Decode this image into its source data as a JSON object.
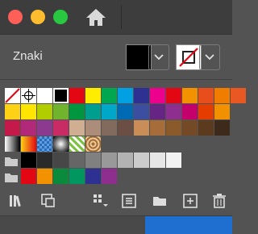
{
  "window": {
    "controls": [
      "close",
      "minimize",
      "maximize"
    ]
  },
  "panel": {
    "title": "Znaki"
  },
  "colors": {
    "row1": [
      "#ffffff",
      "#ffffff",
      "#000000",
      "#e30613",
      "#ffed00",
      "#00a650",
      "#00a0e3",
      "#2e3192",
      "#ec008c",
      "#e30613",
      "#f39200",
      "#e84e1b",
      "#f07d00",
      "#e95822"
    ],
    "row2": [
      "#fcd116",
      "#ffe600",
      "#b1cd00",
      "#6fb42c",
      "#00963f",
      "#009e8e",
      "#00a7c8",
      "#0069b4",
      "#3c4ea0",
      "#662483",
      "#8e2e8e",
      "#c3006b",
      "#e53d00",
      "#f19100"
    ],
    "row3": [
      "#c31a4a",
      "#b3297a",
      "#8b3a8f",
      "#c92c64",
      "#cfae91",
      "#ab8d7a",
      "#826a5c",
      "#6b4f44",
      "#c98d58",
      "#a66c39",
      "#8b5a2b",
      "#744a26",
      "#5c3a1e",
      "#3d2a1a"
    ],
    "row5": [
      "#000000",
      "#2a2a2a",
      "#474747",
      "#666666",
      "#808080",
      "#999999",
      "#b3b3b3",
      "#cccccc",
      "#e6e6e6",
      "#f2f2f2"
    ],
    "row6": [
      "#e30613",
      "#f39200",
      "#0a8a3b",
      "#00965f",
      "#2e3192",
      "#8e2e8e"
    ]
  },
  "toolbar": {
    "icons": [
      "libraries-icon",
      "place-icon",
      "swatch-kinds-icon",
      "swatch-options-icon",
      "new-color-group-icon",
      "new-swatch-icon",
      "delete-icon"
    ]
  }
}
